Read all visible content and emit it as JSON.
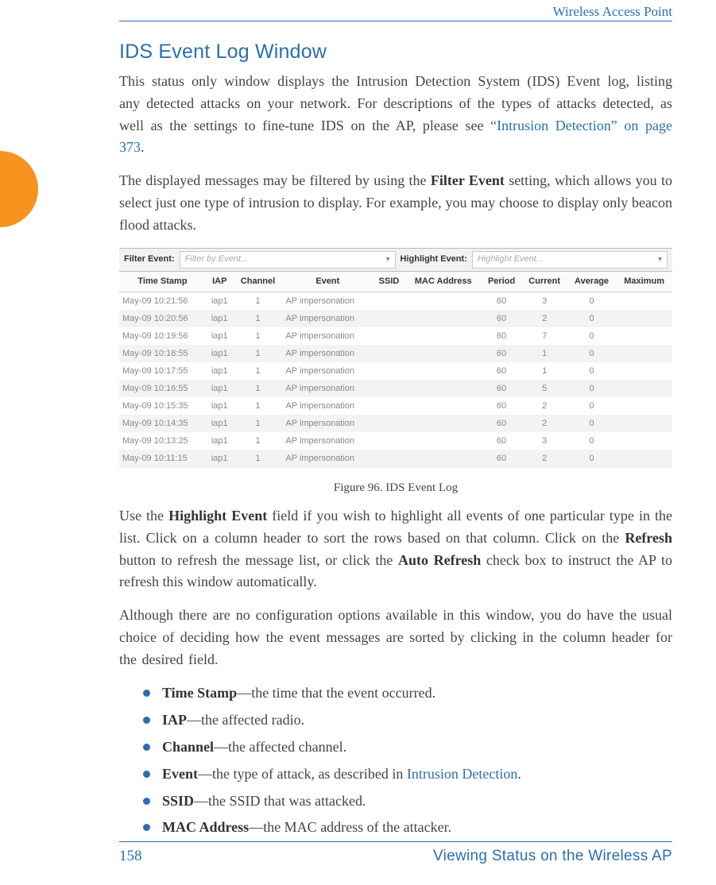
{
  "header": {
    "right": "Wireless Access Point"
  },
  "section_title": "IDS Event Log Window",
  "p1_a": "This status only window displays the Intrusion Detection System (IDS) Event log, listing any detected attacks on your network. For descriptions of the types of attacks detected, as well as the settings to fine-tune IDS on the AP, please see ",
  "p1_link": "“Intrusion Detection” on page 373",
  "p1_b": ".",
  "p2_a": "The displayed messages may be filtered by using the ",
  "p2_bold": "Filter Event",
  "p2_b": " setting, which allows you to select just one type of intrusion to display. For example, you may choose to display only beacon flood attacks.",
  "figbar": {
    "filter_label": "Filter Event:",
    "filter_placeholder": "Filter by Event...",
    "highlight_label": "Highlight Event:",
    "highlight_placeholder": "Highlight Event..."
  },
  "table": {
    "headers": [
      "Time Stamp",
      "IAP",
      "Channel",
      "Event",
      "SSID",
      "MAC Address",
      "Period",
      "Current",
      "Average",
      "Maximum"
    ],
    "rows": [
      [
        "May-09 10:21:56",
        "iap1",
        "1",
        "AP impersonation",
        "",
        "",
        "60",
        "3",
        "0",
        ""
      ],
      [
        "May-09 10:20:56",
        "iap1",
        "1",
        "AP impersonation",
        "",
        "",
        "60",
        "2",
        "0",
        ""
      ],
      [
        "May-09 10:19:56",
        "iap1",
        "1",
        "AP impersonation",
        "",
        "",
        "60",
        "7",
        "0",
        ""
      ],
      [
        "May-09 10:18:55",
        "iap1",
        "1",
        "AP impersonation",
        "",
        "",
        "60",
        "1",
        "0",
        ""
      ],
      [
        "May-09 10:17:55",
        "iap1",
        "1",
        "AP impersonation",
        "",
        "",
        "60",
        "1",
        "0",
        ""
      ],
      [
        "May-09 10:16:55",
        "iap1",
        "1",
        "AP impersonation",
        "",
        "",
        "60",
        "5",
        "0",
        ""
      ],
      [
        "May-09 10:15:35",
        "iap1",
        "1",
        "AP impersonation",
        "",
        "",
        "60",
        "2",
        "0",
        ""
      ],
      [
        "May-09 10:14:35",
        "iap1",
        "1",
        "AP impersonation",
        "",
        "",
        "60",
        "2",
        "0",
        ""
      ],
      [
        "May-09 10:13:25",
        "iap1",
        "1",
        "AP impersonation",
        "",
        "",
        "60",
        "3",
        "0",
        ""
      ],
      [
        "May-09 10:11:15",
        "iap1",
        "1",
        "AP impersonation",
        "",
        "",
        "60",
        "2",
        "0",
        ""
      ]
    ]
  },
  "fig_caption": "Figure 96. IDS Event Log",
  "p3_a": "Use the ",
  "p3_b1": "Highlight Event",
  "p3_b": " field if you wish to highlight all events of one particular type in the list. Click on a column header to sort the rows based on that column. Click on the ",
  "p3_b2": "Refresh",
  "p3_c": " button to refresh the message list, or click the ",
  "p3_b3": "Auto Refresh",
  "p3_d": " check box to instruct the AP to refresh this window automatically.",
  "p4": "Although there are no configuration options available in this window, you do have the usual choice of deciding how the event messages are sorted by clicking in the column header for the desired field.",
  "bullets": [
    {
      "b": "Time Stamp",
      "t": "—the time that the event occurred."
    },
    {
      "b": "IAP",
      "t": "—the affected radio."
    },
    {
      "b": "Channel",
      "t": "—the affected channel."
    },
    {
      "b": "Event",
      "t": "—the type of attack, as described in ",
      "link": "Intrusion Detection",
      "tail": "."
    },
    {
      "b": "SSID",
      "t": "—the SSID that was attacked."
    },
    {
      "b": "MAC Address",
      "t": "—the MAC address of the attacker."
    }
  ],
  "footer": {
    "page_no": "158",
    "right": "Viewing Status on the Wireless AP"
  }
}
